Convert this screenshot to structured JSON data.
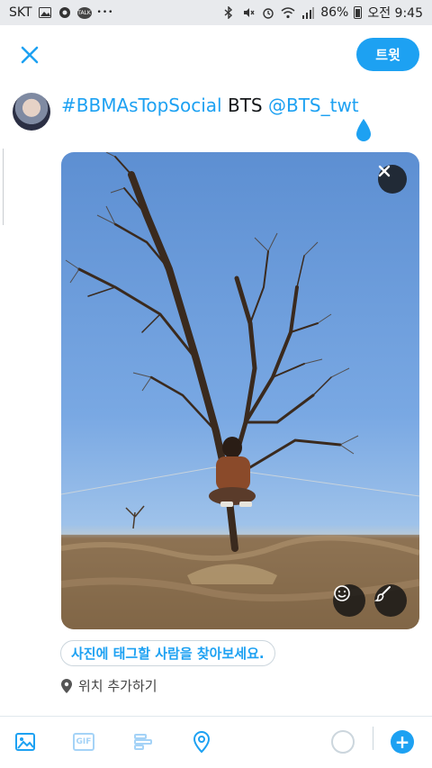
{
  "status_bar": {
    "carrier": "SKT",
    "battery": "86%",
    "time": "오전 9:45",
    "talk_badge": "TALK",
    "more_dots": "•••"
  },
  "header": {
    "tweet_button_label": "트윗"
  },
  "compose": {
    "hashtag": "#BBMAsTopSocial",
    "plain_text": " BTS ",
    "mention": "@BTS_twt"
  },
  "media": {
    "tag_people_label": "사진에 태그할 사람을 찾아보세요."
  },
  "location": {
    "label": "위치 추가하기"
  },
  "toolbar": {
    "gif_label": "GIF",
    "add_label": "+"
  },
  "colors": {
    "accent": "#1da1f2",
    "accent_light": "#a5d3f7",
    "border": "#ccd6dd"
  }
}
